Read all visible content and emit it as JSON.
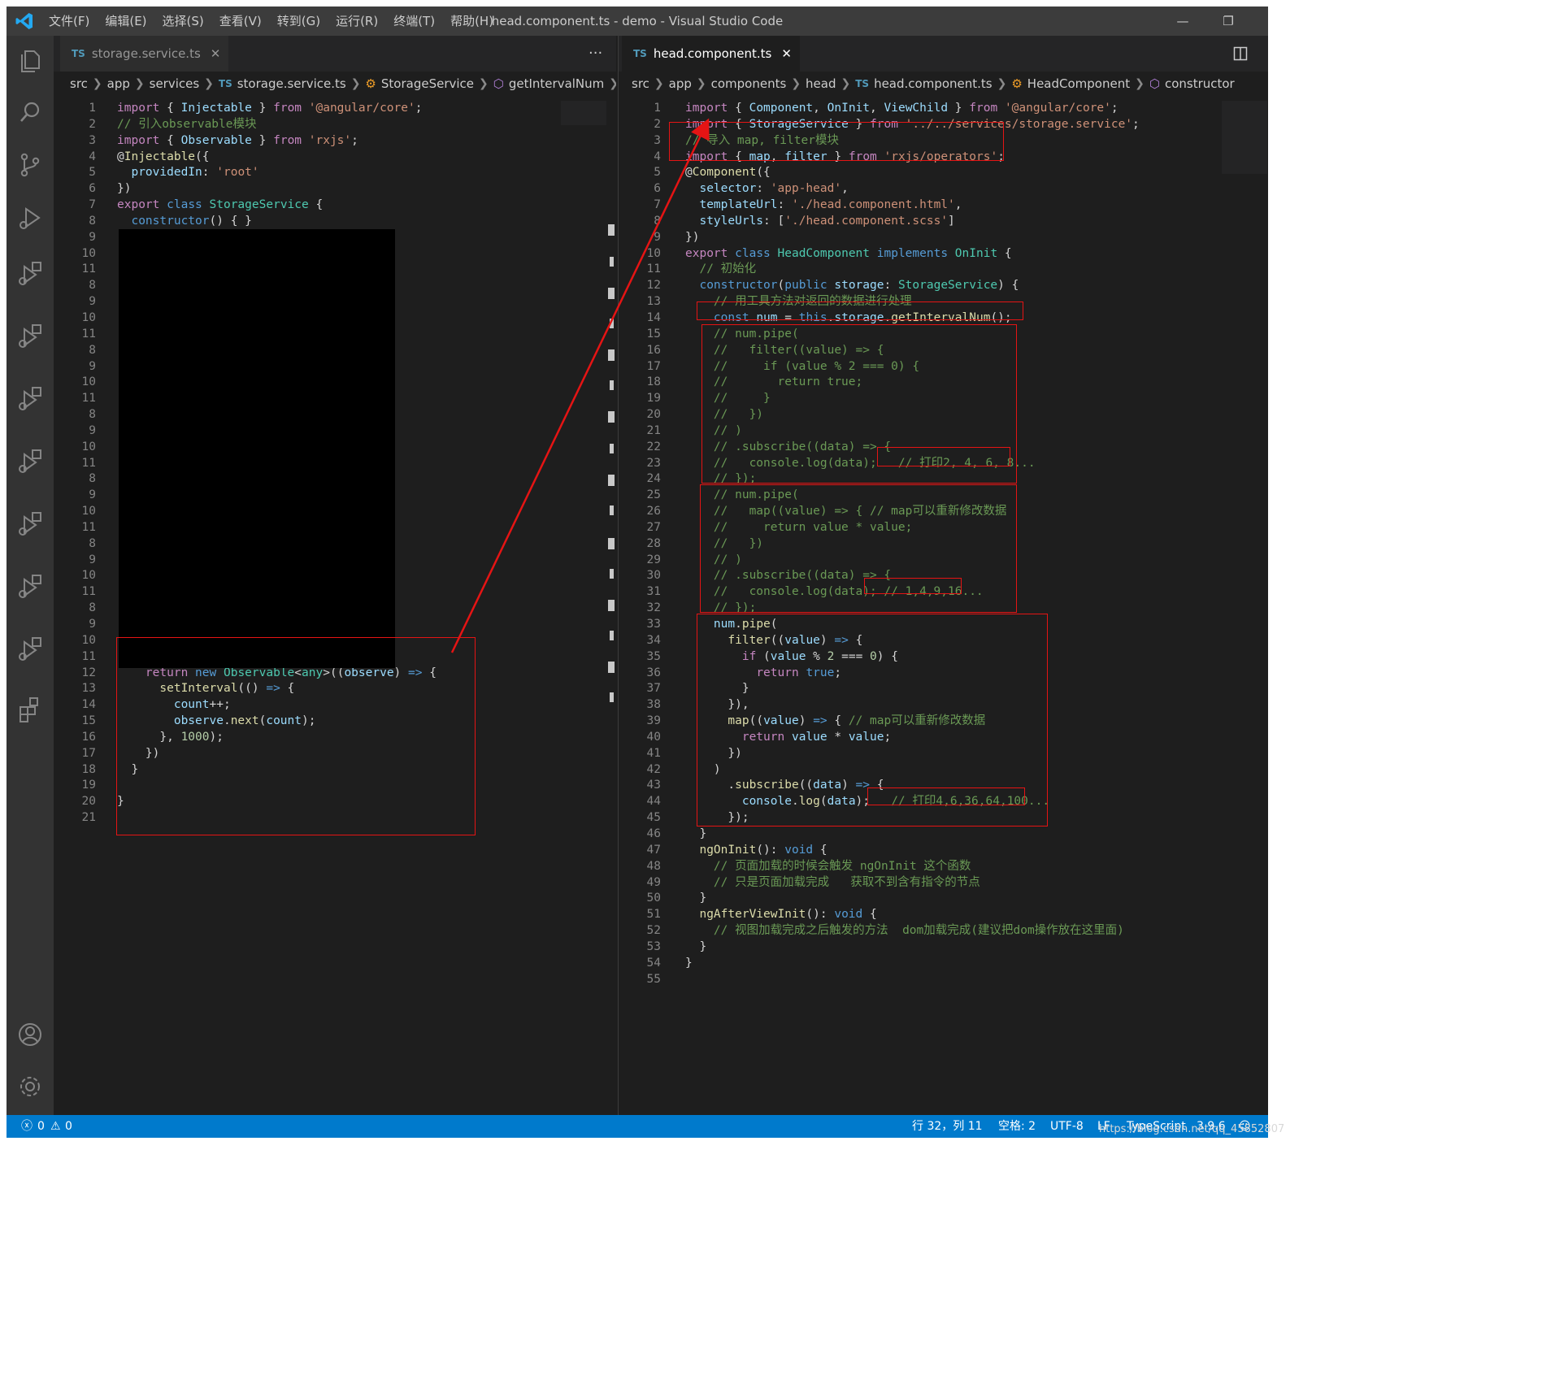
{
  "titlebar": {
    "menu": [
      "文件(F)",
      "编辑(E)",
      "选择(S)",
      "查看(V)",
      "转到(G)",
      "运行(R)",
      "终端(T)",
      "帮助(H)"
    ],
    "window_title": "head.component.ts - demo - Visual Studio Code",
    "minimize_glyph": "—",
    "restore_glyph": "❐"
  },
  "left_editor": {
    "tab": {
      "lang": "TS",
      "label": "storage.service.ts",
      "close": "✕"
    },
    "more_actions": "···",
    "breadcrumb": {
      "lang": "TS",
      "items": [
        "src",
        "app",
        "services",
        "storage.service.ts",
        "StorageService",
        "getIntervalNum"
      ]
    }
  },
  "right_editor": {
    "tab": {
      "lang": "TS",
      "label": "head.component.ts",
      "close": "✕"
    },
    "breadcrumb": {
      "lang": "TS",
      "items": [
        "src",
        "app",
        "components",
        "head",
        "head.component.ts",
        "HeadComponent",
        "constructor"
      ]
    }
  },
  "statusbar": {
    "errors": "0",
    "warnings": "0",
    "position": "行 32，列 11",
    "spaces": "空格: 2",
    "encoding": "UTF-8",
    "eol": "LF",
    "language": "TypeScript",
    "version": "3.9.6",
    "watermark": "https://blog.csdn.net/qq_45852807"
  },
  "accent_colors": {
    "statusbar": "#007acc",
    "annotation": "#e51414"
  }
}
